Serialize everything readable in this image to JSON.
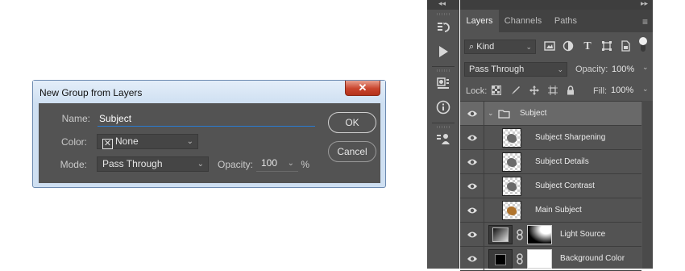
{
  "dialog": {
    "title": "New Group from Layers",
    "close_label": "✕",
    "name_label": "Name:",
    "name_value": "Subject",
    "color_label": "Color:",
    "color_value": "None",
    "mode_label": "Mode:",
    "mode_value": "Pass Through",
    "opacity_label": "Opacity:",
    "opacity_value": "100",
    "opacity_unit": "%",
    "ok_label": "OK",
    "cancel_label": "Cancel"
  },
  "toolstrip": {
    "collapse_label": "◂◂",
    "items": [
      "history-icon",
      "play-actions-icon",
      "properties-icon",
      "info-icon",
      "libraries-icon"
    ]
  },
  "panel": {
    "collapse_label": "▸▸",
    "tabs": [
      {
        "label": "Layers",
        "active": true
      },
      {
        "label": "Channels",
        "active": false
      },
      {
        "label": "Paths",
        "active": false
      }
    ],
    "menu_icon": "≡",
    "filter": {
      "label": "Kind",
      "icons": [
        "image-filter-icon",
        "adjustment-filter-icon",
        "type-filter-icon",
        "shape-filter-icon",
        "smart-object-filter-icon"
      ]
    },
    "blend_mode": "Pass Through",
    "opacity_label": "Opacity:",
    "opacity_value": "100%",
    "lock_label": "Lock:",
    "fill_label": "Fill:",
    "fill_value": "100%",
    "layers": [
      {
        "name": "Subject",
        "type": "group",
        "selected": true
      },
      {
        "name": "Subject Sharpening",
        "type": "pixel"
      },
      {
        "name": "Subject Details",
        "type": "pixel"
      },
      {
        "name": "Subject Contrast",
        "type": "pixel"
      },
      {
        "name": "Main Subject",
        "type": "pixel-color"
      },
      {
        "name": "Light Source",
        "type": "gradient-mask"
      },
      {
        "name": "Background Color",
        "type": "fill-mask"
      }
    ]
  },
  "colors": {
    "panel_bg": "#535353",
    "selected_row": "#696969",
    "accent_blue": "#2a7cd3",
    "close_red": "#c9442d"
  }
}
